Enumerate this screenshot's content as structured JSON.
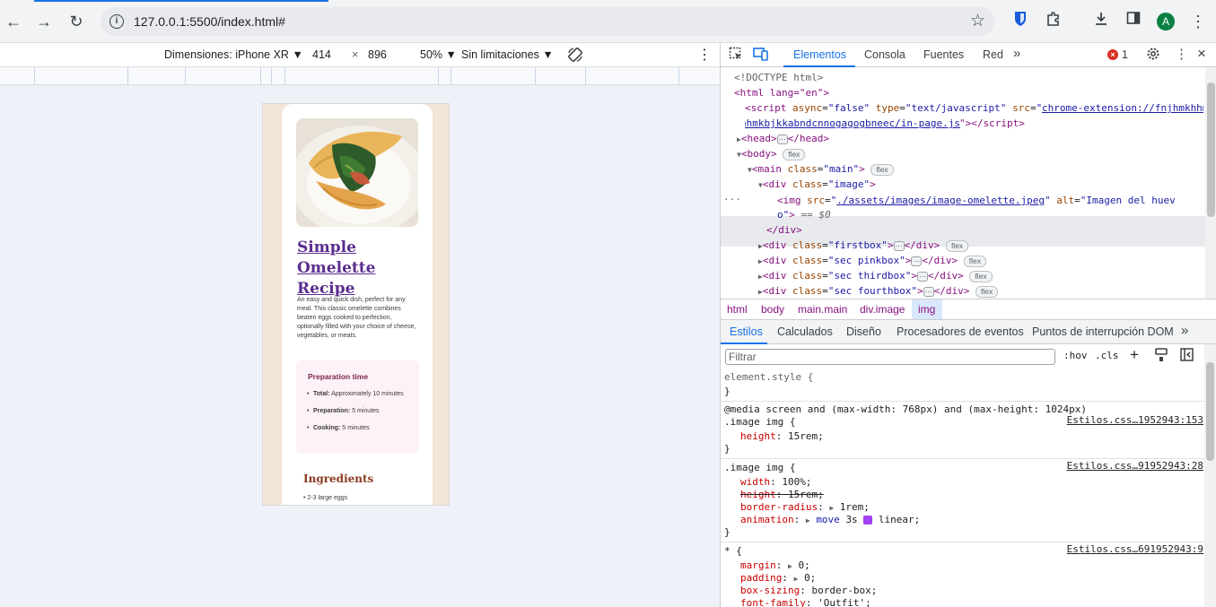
{
  "browser": {
    "url": "127.0.0.1:5500/index.html#",
    "profile_initial": "A"
  },
  "device_toolbar": {
    "dimensions_label": "Dimensiones: iPhone XR",
    "width": "414",
    "times": "×",
    "height": "896",
    "zoom": "50%",
    "throttle": "Sin limitaciones"
  },
  "page": {
    "title": "Simple Omelette Recipe",
    "description": "An easy and quick dish, perfect for any meal. This classic omelette combines beaten eggs cooked to perfection, optionally filled with your choice of cheese, vegetables, or meats.",
    "prep_title": "Preparation time",
    "prep_items": [
      {
        "label": "Total:",
        "value": "Approximately 10 minutes"
      },
      {
        "label": "Preparation:",
        "value": "5 minutes"
      },
      {
        "label": "Cooking:",
        "value": "5 minutes"
      }
    ],
    "ingredients_title": "Ingredients",
    "first_ingredient": "2-3 large eggs"
  },
  "devtools": {
    "tabs": [
      "Elementos",
      "Consola",
      "Fuentes",
      "Red"
    ],
    "error_count": "1",
    "breadcrumbs": [
      "html",
      "body",
      "main.main",
      "div.image",
      "img"
    ],
    "styles_tabs": [
      "Estilos",
      "Calculados",
      "Diseño",
      "Procesadores de eventos",
      "Puntos de interrupción DOM"
    ],
    "filter_placeholder": "Filtrar",
    "hov": ":hov",
    "cls": ".cls",
    "dom": {
      "doctype": "<!DOCTYPE html>",
      "html_open": "<html lang=\"en\">",
      "script_src": "chrome-extension://fnjhmkhhmkbjkkabndcnnogagogbneec/in-page.js",
      "img_src": "./assets/images/image-omelette.jpeg",
      "img_alt": "Imagen del huevo",
      "flex": "flex",
      "eq": "== $0"
    },
    "styles": {
      "element_style": "element.style {",
      "media": "@media screen and (max-width: 768px) and (max-height: 1024px)",
      "rule1_selector": ".image img {",
      "rule1_src": "Estilos.css…1952943:153",
      "rule2_selector": ".image img {",
      "rule2_src": "Estilos.css…91952943:28",
      "rule3_selector": "* {",
      "rule3_src": "Estilos.css…691952943:9"
    }
  }
}
